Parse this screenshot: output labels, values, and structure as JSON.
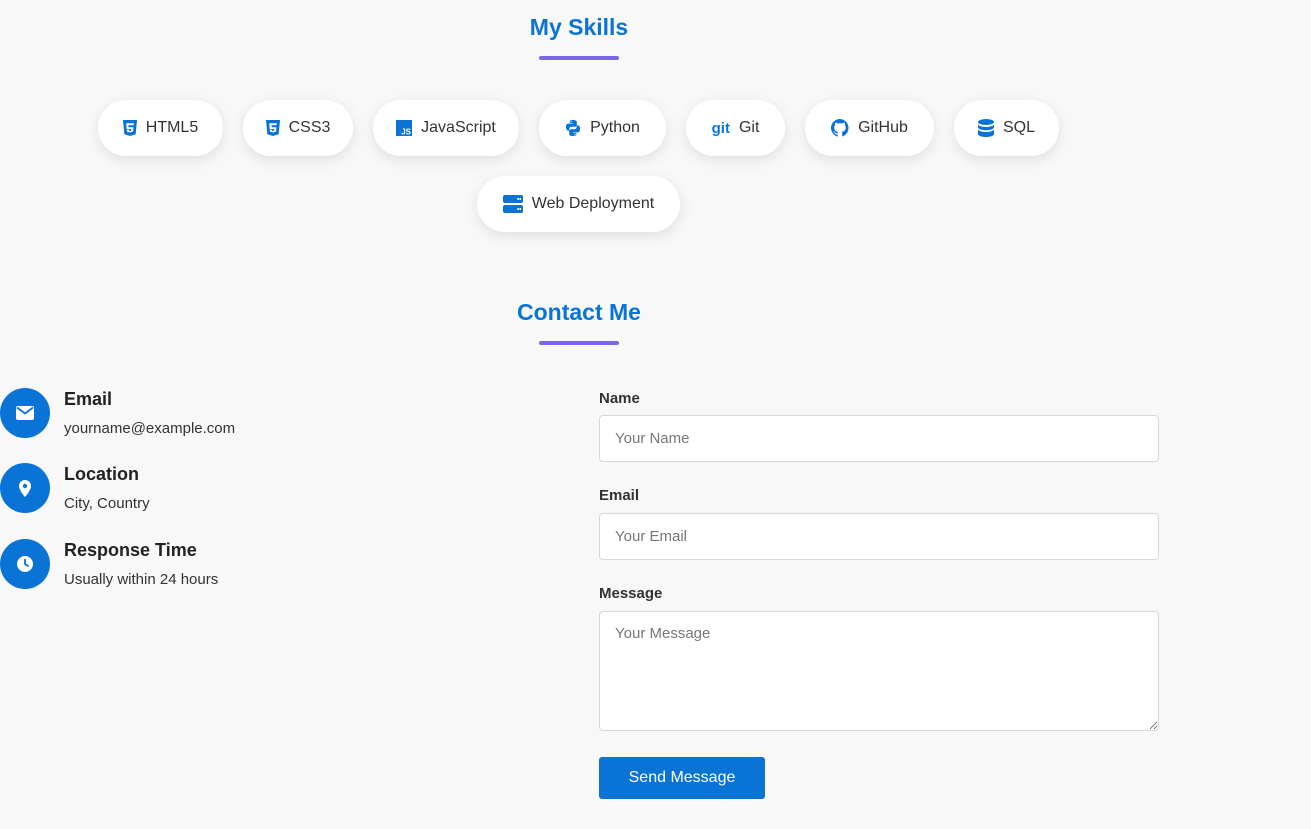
{
  "skills_section": {
    "title": "My Skills",
    "skills": [
      {
        "label": "HTML5",
        "icon": "html5-icon"
      },
      {
        "label": "CSS3",
        "icon": "css3-icon"
      },
      {
        "label": "JavaScript",
        "icon": "javascript-icon"
      },
      {
        "label": "Python",
        "icon": "python-icon"
      },
      {
        "label": "Git",
        "icon": "git-icon",
        "icon_text": "git"
      },
      {
        "label": "GitHub",
        "icon": "github-icon"
      },
      {
        "label": "SQL",
        "icon": "database-icon"
      },
      {
        "label": "Web Deployment",
        "icon": "server-icon"
      }
    ]
  },
  "contact_section": {
    "title": "Contact Me",
    "info": [
      {
        "heading": "Email",
        "value": "yourname@example.com",
        "icon": "envelope-icon"
      },
      {
        "heading": "Location",
        "value": "City, Country",
        "icon": "map-pin-icon"
      },
      {
        "heading": "Response Time",
        "value": "Usually within 24 hours",
        "icon": "clock-icon"
      }
    ],
    "form": {
      "name_label": "Name",
      "name_placeholder": "Your Name",
      "email_label": "Email",
      "email_placeholder": "Your Email",
      "message_label": "Message",
      "message_placeholder": "Your Message",
      "submit_label": "Send Message"
    }
  },
  "colors": {
    "accent": "#0a74d6",
    "underline": "#7a67e8",
    "background": "#f8f8f8"
  }
}
